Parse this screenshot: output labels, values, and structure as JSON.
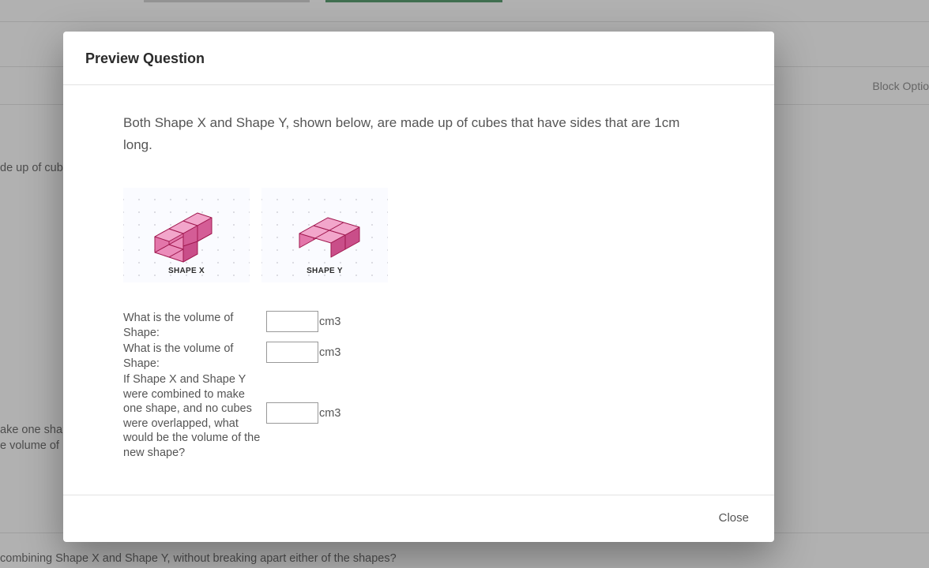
{
  "background": {
    "blockOptions": "Block Optio",
    "fragment1": "de up of cub",
    "fragment2": "ake one shap",
    "fragment3": "e volume of",
    "fragment4": "combining Shape X and Shape Y, without breaking apart either of the shapes?"
  },
  "modal": {
    "title": "Preview Question",
    "intro": "Both Shape X and Shape Y, shown below, are made up of cubes that have sides that are 1cm long.",
    "shapeXLabel": "SHAPE X",
    "shapeYLabel": "SHAPE Y",
    "fields": {
      "q1": {
        "label": "What is the volume of Shape:",
        "unit": "cm3",
        "value": ""
      },
      "q2": {
        "label": "What is the volume of Shape:",
        "unit": "cm3",
        "value": ""
      },
      "q3": {
        "label": "If Shape X and Shape Y were combined to make one shape, and no cubes were overlapped, what would be the volume of the new shape?",
        "unit": "cm3",
        "value": ""
      }
    },
    "closeLabel": "Close"
  }
}
